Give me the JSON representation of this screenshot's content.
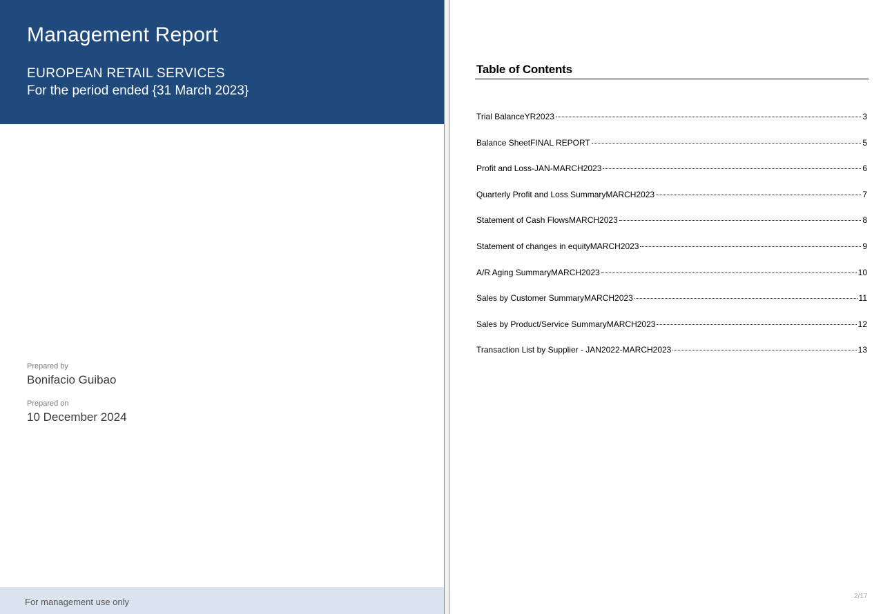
{
  "cover": {
    "title": "Management Report",
    "company": "EUROPEAN RETAIL SERVICES",
    "period": "For the period ended {31 March 2023}",
    "prepared_by_label": "Prepared by",
    "prepared_by": "Bonifacio Guibao",
    "prepared_on_label": "Prepared on",
    "prepared_on": "10 December 2024",
    "footer": "For management use only",
    "colors": {
      "header_bg": "#204a7c",
      "footer_bg": "#dbe3ef"
    }
  },
  "toc": {
    "heading": "Table of Contents",
    "items": [
      {
        "title": "Trial BalanceYR2023",
        "page": "3"
      },
      {
        "title": "Balance SheetFINAL REPORT",
        "page": "5"
      },
      {
        "title": "Profit and Loss-JAN-MARCH2023",
        "page": "6"
      },
      {
        "title": "Quarterly Profit and Loss SummaryMARCH2023",
        "page": "7"
      },
      {
        "title": "Statement of Cash FlowsMARCH2023",
        "page": "8"
      },
      {
        "title": "Statement of changes in equityMARCH2023",
        "page": "9"
      },
      {
        "title": "A/R Aging SummaryMARCH2023",
        "page": "10"
      },
      {
        "title": "Sales by Customer SummaryMARCH2023",
        "page": "11"
      },
      {
        "title": "Sales by Product/Service SummaryMARCH2023",
        "page": "12"
      },
      {
        "title": "Transaction List by Supplier - JAN2022-MARCH2023",
        "page": "13"
      }
    ],
    "page_indicator": "2/17"
  }
}
